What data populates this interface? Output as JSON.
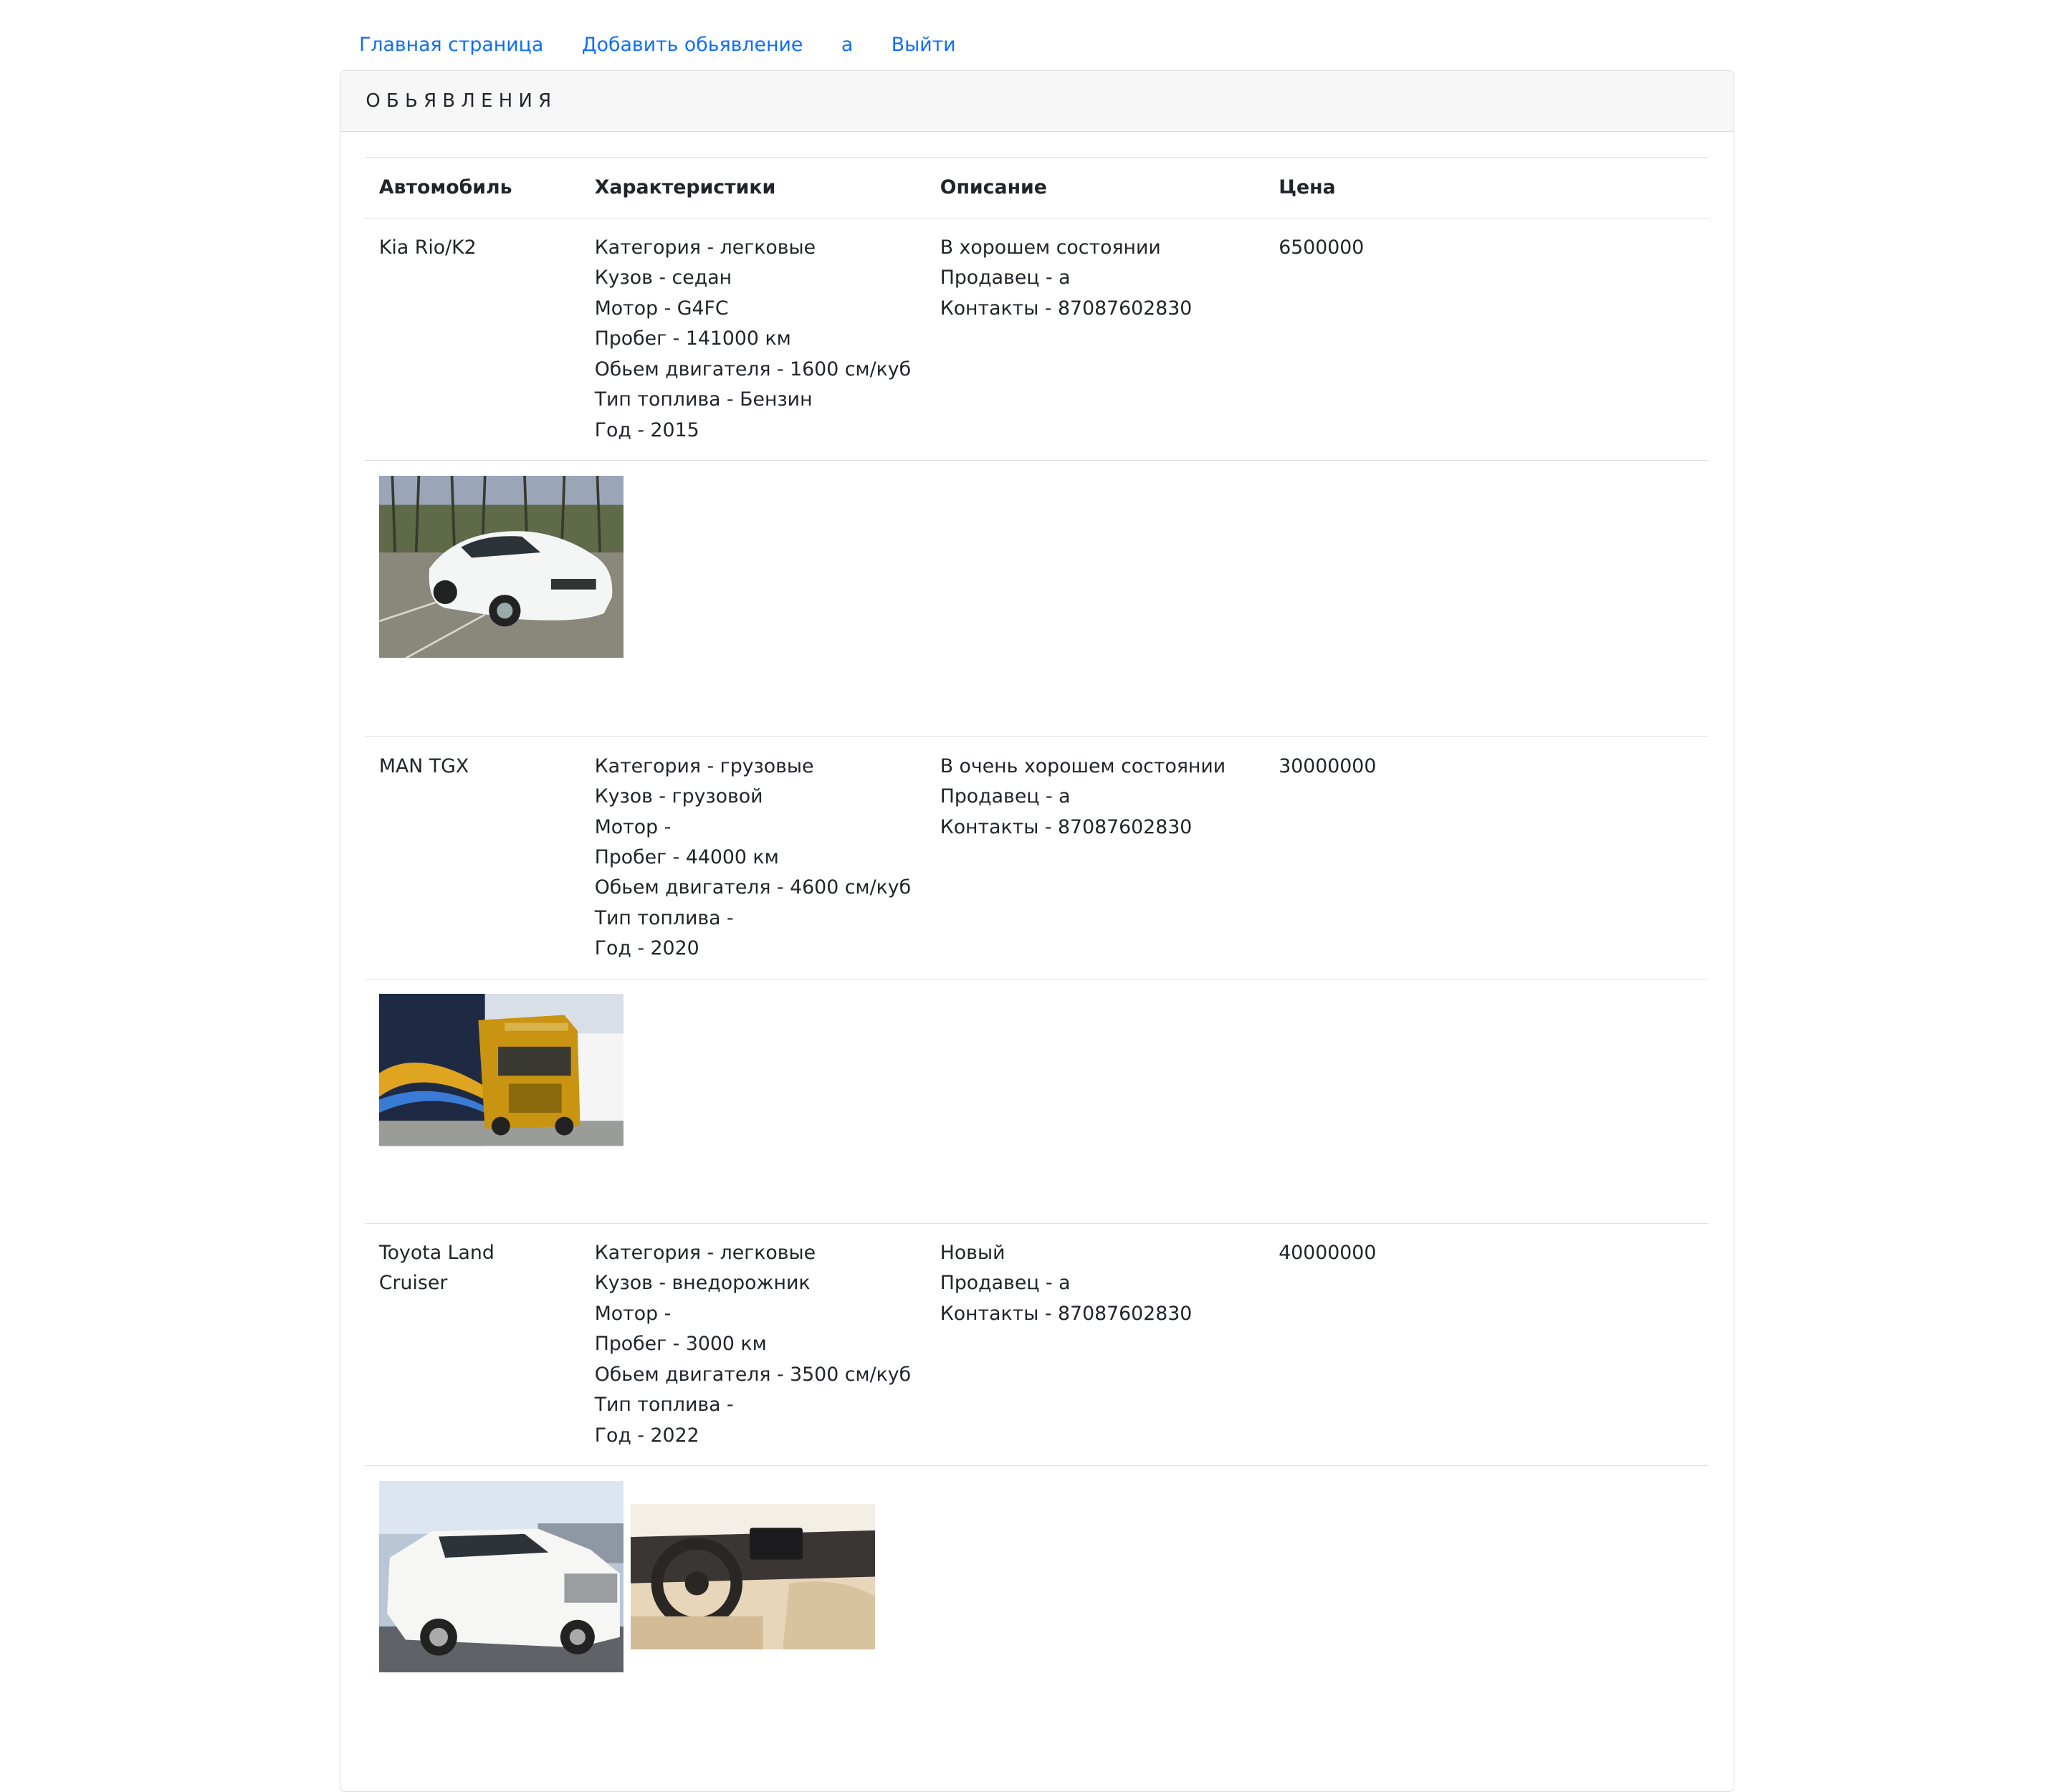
{
  "nav": {
    "home": "Главная страница",
    "add": "Добавить обьявление",
    "user": "а",
    "logout": "Выйти"
  },
  "card": {
    "title": "ОБЬЯВЛЕНИЯ"
  },
  "table": {
    "headers": [
      "Автомобиль",
      "Характеристики",
      "Описание",
      "Цена"
    ],
    "rows": [
      {
        "car": "Kia Rio/K2",
        "specs": [
          "Категория - легковые",
          "Кузов - седан",
          "Мотор - G4FC",
          "Пробег - 141000 км",
          "Обьем двигателя - 1600 см/куб",
          "Тип топлива - Бензин",
          "Год - 2015"
        ],
        "desc": [
          "В хорошем состоянии",
          "Продавец - а",
          "Контакты - 87087602830"
        ],
        "price": "6500000",
        "photos": [
          "white-sedan-photo"
        ]
      },
      {
        "car": "MAN TGX",
        "specs": [
          "Категория - грузовые",
          "Кузов - грузовой",
          "Мотор -",
          "Пробег - 44000 км",
          "Обьем двигателя - 4600 см/куб",
          "Тип топлива -",
          "Год - 2020"
        ],
        "desc": [
          "В очень хорошем состоянии",
          "Продавец - а",
          "Контакты - 87087602830"
        ],
        "price": "30000000",
        "photos": [
          "yellow-truck-photo"
        ]
      },
      {
        "car": "Toyota Land Cruiser",
        "specs": [
          "Категория - легковые",
          "Кузов - внедорожник",
          "Мотор -",
          "Пробег - 3000 км",
          "Обьем двигателя - 3500 см/куб",
          "Тип топлива -",
          "Год - 2022"
        ],
        "desc": [
          "Новый",
          "Продавец - а",
          "Контакты - 87087602830"
        ],
        "price": "40000000",
        "photos": [
          "white-suv-photo",
          "suv-interior-photo"
        ]
      }
    ]
  },
  "colors": {
    "link": "#0d6efd",
    "header_bg": "#f7f7f7",
    "border": "#dee2e6"
  }
}
